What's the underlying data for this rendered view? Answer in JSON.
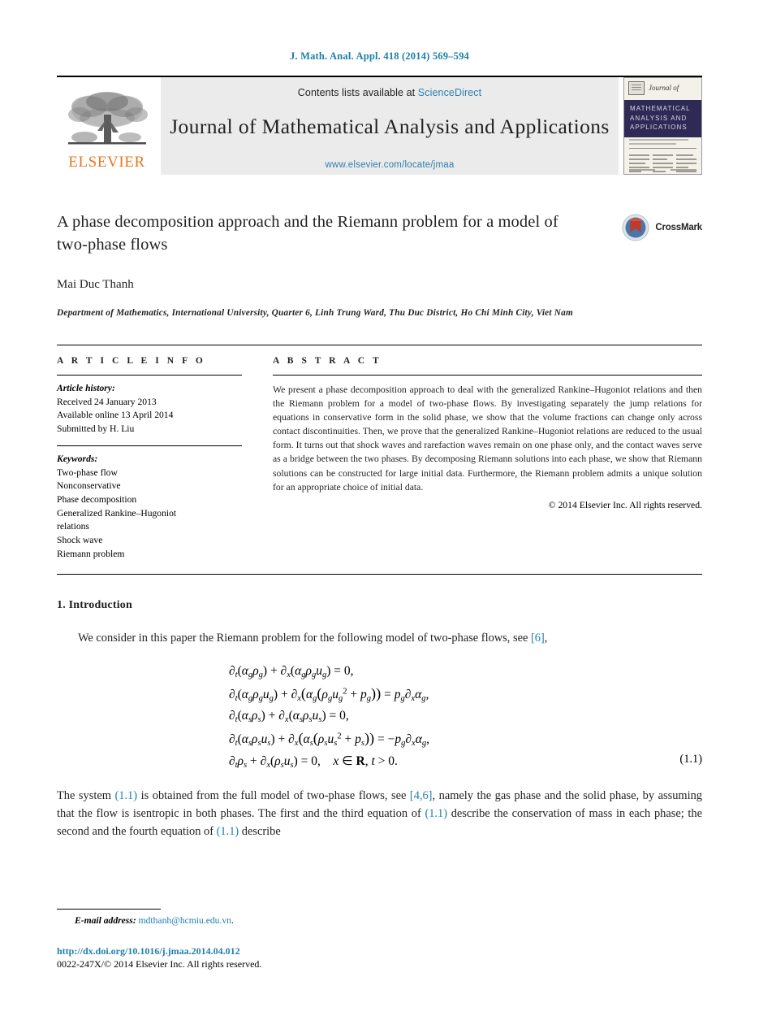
{
  "running_head": "J. Math. Anal. Appl. 418 (2014) 569–594",
  "masthead": {
    "contents_prefix": "Contents lists available at ",
    "sciencedirect": "ScienceDirect",
    "journal_title": "Journal of Mathematical Analysis and Applications",
    "journal_url": "www.elsevier.com/locate/jmaa",
    "publisher_wordmark": "ELSEVIER",
    "cover": {
      "journal_of": "Journal of",
      "band_line1": "MATHEMATICAL",
      "band_line2": "ANALYSIS AND",
      "band_line3": "APPLICATIONS"
    }
  },
  "article": {
    "title": "A phase decomposition approach and the Riemann problem for a model of two-phase flows",
    "crossmark_label": "CrossMark",
    "author": "Mai Duc Thanh",
    "affiliation": "Department of Mathematics, International University, Quarter 6, Linh Trung Ward, Thu Duc District, Ho Chi Minh City, Viet Nam"
  },
  "info": {
    "heading": "A R T I C L E   I N F O",
    "history_label": "Article history:",
    "history": [
      "Received 24 January 2013",
      "Available online 13 April 2014",
      "Submitted by H. Liu"
    ],
    "keywords_label": "Keywords:",
    "keywords": [
      "Two-phase flow",
      "Nonconservative",
      "Phase decomposition",
      "Generalized Rankine–Hugoniot",
      "relations",
      "Shock wave",
      "Riemann problem"
    ]
  },
  "abstract": {
    "heading": "A B S T R A C T",
    "text": "We present a phase decomposition approach to deal with the generalized Rankine–Hugoniot relations and then the Riemann problem for a model of two-phase flows. By investigating separately the jump relations for equations in conservative form in the solid phase, we show that the volume fractions can change only across contact discontinuities. Then, we prove that the generalized Rankine–Hugoniot relations are reduced to the usual form. It turns out that shock waves and rarefaction waves remain on one phase only, and the contact waves serve as a bridge between the two phases. By decomposing Riemann solutions into each phase, we show that Riemann solutions can be constructed for large initial data. Furthermore, the Riemann problem admits a unique solution for an appropriate choice of initial data.",
    "copyright": "© 2014 Elsevier Inc. All rights reserved."
  },
  "body": {
    "section_heading": "1. Introduction",
    "para1_before": "We consider in this paper the Riemann problem for the following model of two-phase flows, see ",
    "para1_ref": "[6]",
    "para1_after": ",",
    "equations": {
      "number": "(1.1)",
      "lines": [
        "∂t(αgρg) + ∂x(αgρgug) = 0,",
        "∂t(αgρgug) + ∂x(αg(ρgug² + pg)) = pg∂xαg,",
        "∂t(αsρs) + ∂x(αsρsus) = 0,",
        "∂t(αsρsus) + ∂x(αs(ρsus² + ps)) = −pg∂xαg,",
        "∂tρs + ∂x(ρsus) = 0,   x ∈ R, t > 0."
      ]
    },
    "para2": {
      "t1": "The system ",
      "r1": "(1.1)",
      "t2": " is obtained from the full model of two-phase flows, see ",
      "r2": "[4,6]",
      "t3": ", namely the gas phase and the solid phase, by assuming that the flow is isentropic in both phases. The first and the third equation of ",
      "r3": "(1.1)",
      "t4": " describe the conservation of mass in each phase; the second and the fourth equation of ",
      "r4": "(1.1)",
      "t5": " describe"
    }
  },
  "footer": {
    "email_label": "E-mail address:",
    "email_address": "mdthanh@hcmiu.edu.vn",
    "email_period": ".",
    "doi": "http://dx.doi.org/10.1016/j.jmaa.2014.04.012",
    "issn_line": "0022-247X/© 2014 Elsevier Inc. All rights reserved."
  },
  "colors": {
    "link": "#1f7fae",
    "elsevier_orange": "#E87722",
    "band_navy": "#2e2a56",
    "masthead_gray": "#ebebeb"
  }
}
